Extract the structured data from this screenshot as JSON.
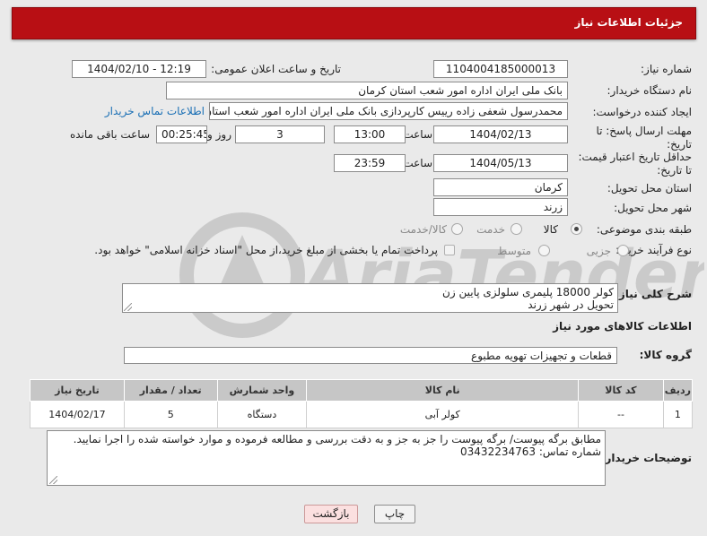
{
  "header": {
    "title": "جزئیات اطلاعات نیاز"
  },
  "form": {
    "need_number_label": "شماره نیاز:",
    "need_number": "1104004185000013",
    "announce_label": "تاریخ و ساعت اعلان عمومی:",
    "announce_value": "1404/02/10 - 12:19",
    "buyer_org_label": "نام دستگاه خریدار:",
    "buyer_org": "بانک ملی ایران اداره امور شعب استان کرمان",
    "creator_label": "ایجاد کننده درخواست:",
    "creator": "محمدرسول شعفی زاده رییس کارپردازی بانک ملی ایران اداره امور شعب استان",
    "contact_link": "اطلاعات تماس خریدار",
    "reply_deadline_label": "مهلت ارسال پاسخ: تا تاریخ:",
    "reply_date": "1404/02/13",
    "time_label": "ساعت",
    "reply_time": "13:00",
    "days_value": "3",
    "days_label": "روز و",
    "remaining_value": "00:25:45",
    "remaining_label": "ساعت باقی مانده",
    "price_validity_label": "حداقل تاریخ اعتبار قیمت: تا تاریخ:",
    "price_date": "1404/05/13",
    "price_time": "23:59",
    "province_label": "استان محل تحویل:",
    "province": "کرمان",
    "city_label": "شهر محل تحویل:",
    "city": "زرند",
    "category_label": "طبقه بندی موضوعی:",
    "category_options": [
      "کالا",
      "خدمت",
      "کالا/خدمت"
    ],
    "process_label": "نوع فرآیند خرید :",
    "process_options": [
      "جزیی",
      "متوسط"
    ],
    "payment_note": "پرداخت تمام یا بخشی از مبلغ خرید،از محل \"اسناد خزانه اسلامی\" خواهد بود."
  },
  "summary": {
    "label": "شرح کلی نیاز:",
    "text": "کولر 18000 پلیمری سلولزی پایین زن\nتحویل در شهر زرند"
  },
  "goods_info": {
    "title": "اطلاعات کالاهای مورد نیاز",
    "group_label": "گروه کالا:",
    "group_value": "قطعات و تجهیزات تهویه مطبوع"
  },
  "table": {
    "headers": [
      "ردیف",
      "کد کالا",
      "نام کالا",
      "واحد شمارش",
      "تعداد / مقدار",
      "تاریخ نیاز"
    ],
    "rows": [
      [
        "1",
        "--",
        "کولر آبی",
        "دستگاه",
        "5",
        "1404/02/17"
      ]
    ]
  },
  "buyer_notes": {
    "label": "توضیحات خریدار:",
    "text": "مطابق برگه پیوست/ برگه پیوست را جز به جز و به دقت بررسی و مطالعه فرموده و موارد خواسته شده را اجرا نمایید.\nشماره تماس: 03432234763"
  },
  "buttons": {
    "print": "چاپ",
    "back": "بازگشت"
  },
  "watermark": {
    "text": "AriaTender.neT"
  },
  "colors": {
    "header": "#b80f14",
    "link": "#1a6fb5",
    "table_header": "#c6c6c6"
  }
}
